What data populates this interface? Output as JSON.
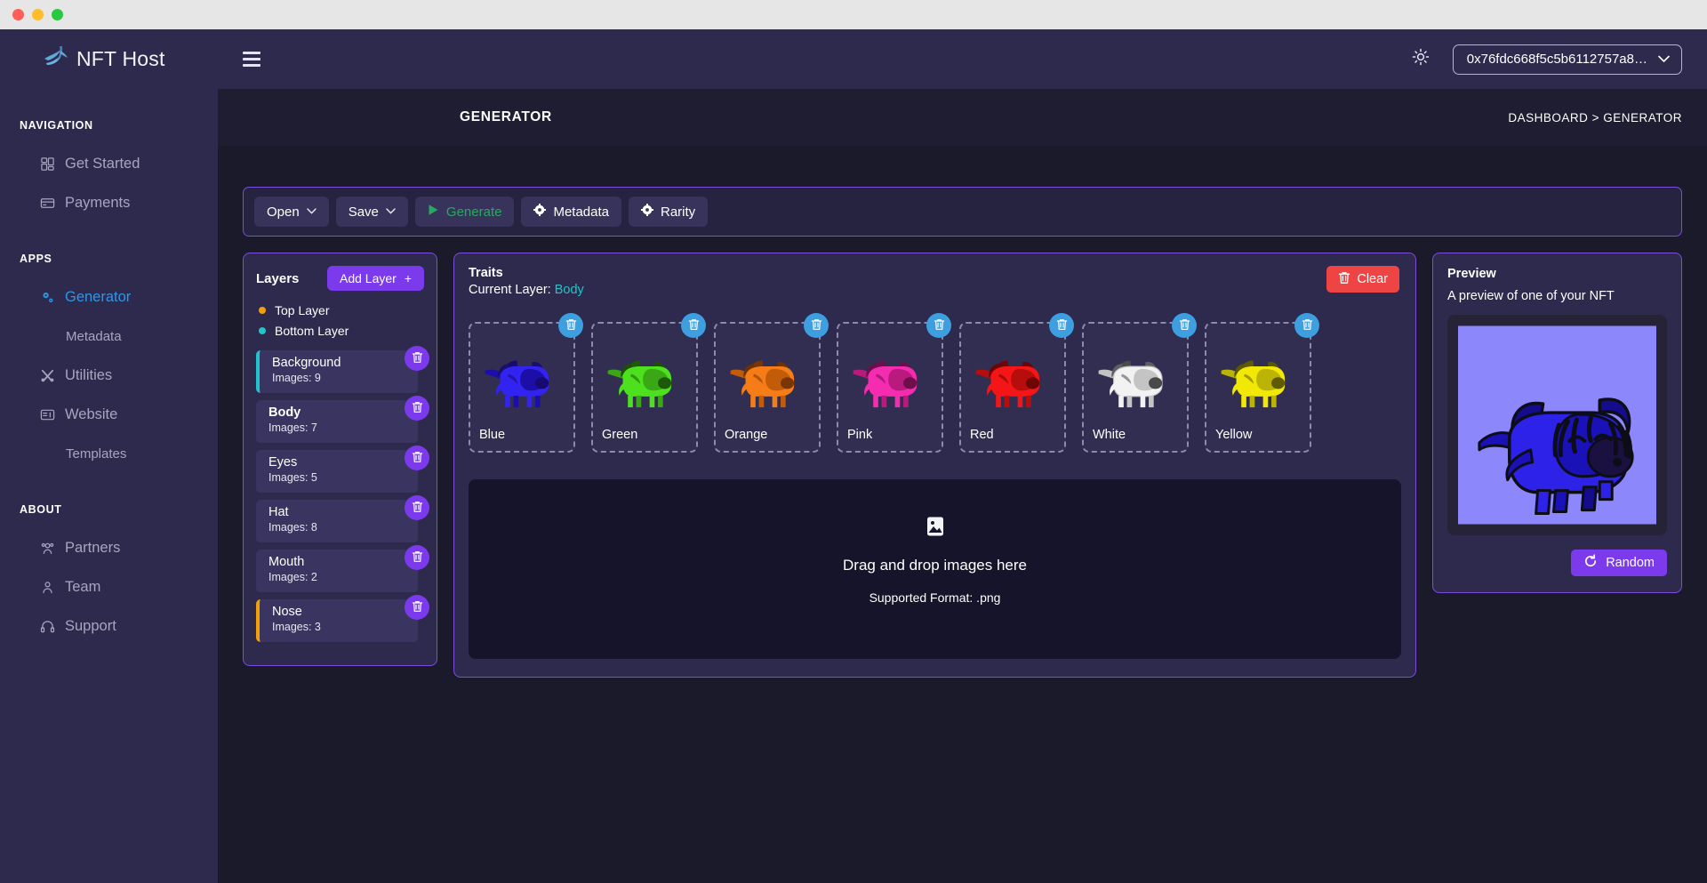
{
  "window": {
    "traffic_lights": [
      "close",
      "minimize",
      "maximize"
    ]
  },
  "brand": {
    "name": "NFT Host",
    "logo_icon": "bird-logo-icon"
  },
  "sidebar": {
    "sections": [
      {
        "heading": "NAVIGATION",
        "items": [
          {
            "label": "Get Started",
            "icon": "grid-icon",
            "active": false,
            "sub": false
          },
          {
            "label": "Payments",
            "icon": "card-icon",
            "active": false,
            "sub": false
          }
        ]
      },
      {
        "heading": "APPS",
        "items": [
          {
            "label": "Generator",
            "icon": "gears-icon",
            "active": true,
            "sub": false
          },
          {
            "label": "Metadata",
            "icon": "",
            "active": false,
            "sub": true
          },
          {
            "label": "Utilities",
            "icon": "tools-icon",
            "active": false,
            "sub": false
          },
          {
            "label": "Website",
            "icon": "browser-icon",
            "active": false,
            "sub": false
          },
          {
            "label": "Templates",
            "icon": "",
            "active": false,
            "sub": true
          }
        ]
      },
      {
        "heading": "ABOUT",
        "items": [
          {
            "label": "Partners",
            "icon": "people-icon",
            "active": false,
            "sub": false
          },
          {
            "label": "Team",
            "icon": "person-icon",
            "active": false,
            "sub": false
          },
          {
            "label": "Support",
            "icon": "headset-icon",
            "active": false,
            "sub": false
          }
        ]
      }
    ]
  },
  "topbar": {
    "menu_icon": "hamburger-icon",
    "theme_icon": "sun-icon",
    "wallet_address": "0x76fdc668f5c5b6112757a8…",
    "wallet_caret": "chevron-down-icon"
  },
  "header": {
    "page_title": "GENERATOR",
    "breadcrumb": "DASHBOARD > GENERATOR"
  },
  "toolbar": {
    "buttons": [
      {
        "label": "Open",
        "icon": "",
        "caret": "∨",
        "accent": ""
      },
      {
        "label": "Save",
        "icon": "",
        "caret": "∨",
        "accent": ""
      },
      {
        "label": "Generate",
        "icon": "play-icon",
        "caret": "",
        "accent": "#2aa863"
      },
      {
        "label": "Metadata",
        "icon": "gear-icon",
        "caret": "",
        "accent": ""
      },
      {
        "label": "Rarity",
        "icon": "gear-icon",
        "caret": "",
        "accent": ""
      }
    ]
  },
  "layers": {
    "title": "Layers",
    "add_label": "Add Layer",
    "add_plus": "+",
    "legend": [
      {
        "label": "Top Layer",
        "color": "#f2a007"
      },
      {
        "label": "Bottom Layer",
        "color": "#22c3c9"
      }
    ],
    "items": [
      {
        "name": "Background",
        "count_label": "Images: 9",
        "marker": "bottom",
        "selected": false
      },
      {
        "name": "Body",
        "count_label": "Images: 7",
        "marker": "none",
        "selected": true
      },
      {
        "name": "Eyes",
        "count_label": "Images: 5",
        "marker": "none",
        "selected": false
      },
      {
        "name": "Hat",
        "count_label": "Images: 8",
        "marker": "none",
        "selected": false
      },
      {
        "name": "Mouth",
        "count_label": "Images: 2",
        "marker": "none",
        "selected": false
      },
      {
        "name": "Nose",
        "count_label": "Images: 3",
        "marker": "top",
        "selected": false
      }
    ],
    "delete_icon": "trash-icon"
  },
  "traits": {
    "title": "Traits",
    "current_layer_prefix": "Current Layer: ",
    "current_layer_value": "Body",
    "clear_label": "Clear",
    "clear_icon": "trash-icon",
    "delete_icon": "trash-icon",
    "items": [
      {
        "label": "Blue",
        "body": "#3224f0",
        "shade": "#1c0fa8",
        "dark": "#160a70",
        "horn": "#1a0f6b"
      },
      {
        "label": "Green",
        "body": "#4ce01e",
        "shade": "#3aa815",
        "dark": "#1d5a08",
        "horn": "#1d4d07"
      },
      {
        "label": "Orange",
        "body": "#f57c16",
        "shade": "#c25c08",
        "dark": "#7a3504",
        "horn": "#6e3103"
      },
      {
        "label": "Pink",
        "body": "#f52bb0",
        "shade": "#b81a7e",
        "dark": "#6e0f4b",
        "horn": "#6b0f49"
      },
      {
        "label": "Red",
        "body": "#f41616",
        "shade": "#b80d0d",
        "dark": "#6e0606",
        "horn": "#6b0505"
      },
      {
        "label": "White",
        "body": "#f2f2f2",
        "shade": "#c4c4c4",
        "dark": "#4a4a4a",
        "horn": "#5e5e5e"
      },
      {
        "label": "Yellow",
        "body": "#f2e806",
        "shade": "#bcb405",
        "dark": "#5f5b02",
        "horn": "#5c5802"
      }
    ]
  },
  "dropzone": {
    "icon": "image-icon",
    "text": "Drag and drop images here",
    "sub": "Supported Format: .png"
  },
  "preview": {
    "title": "Preview",
    "subtitle": "A preview of one of your NFT",
    "background_color": "#8c87fa",
    "body_color": "#2d22e8",
    "random_label": "Random",
    "random_icon": "refresh-icon"
  }
}
